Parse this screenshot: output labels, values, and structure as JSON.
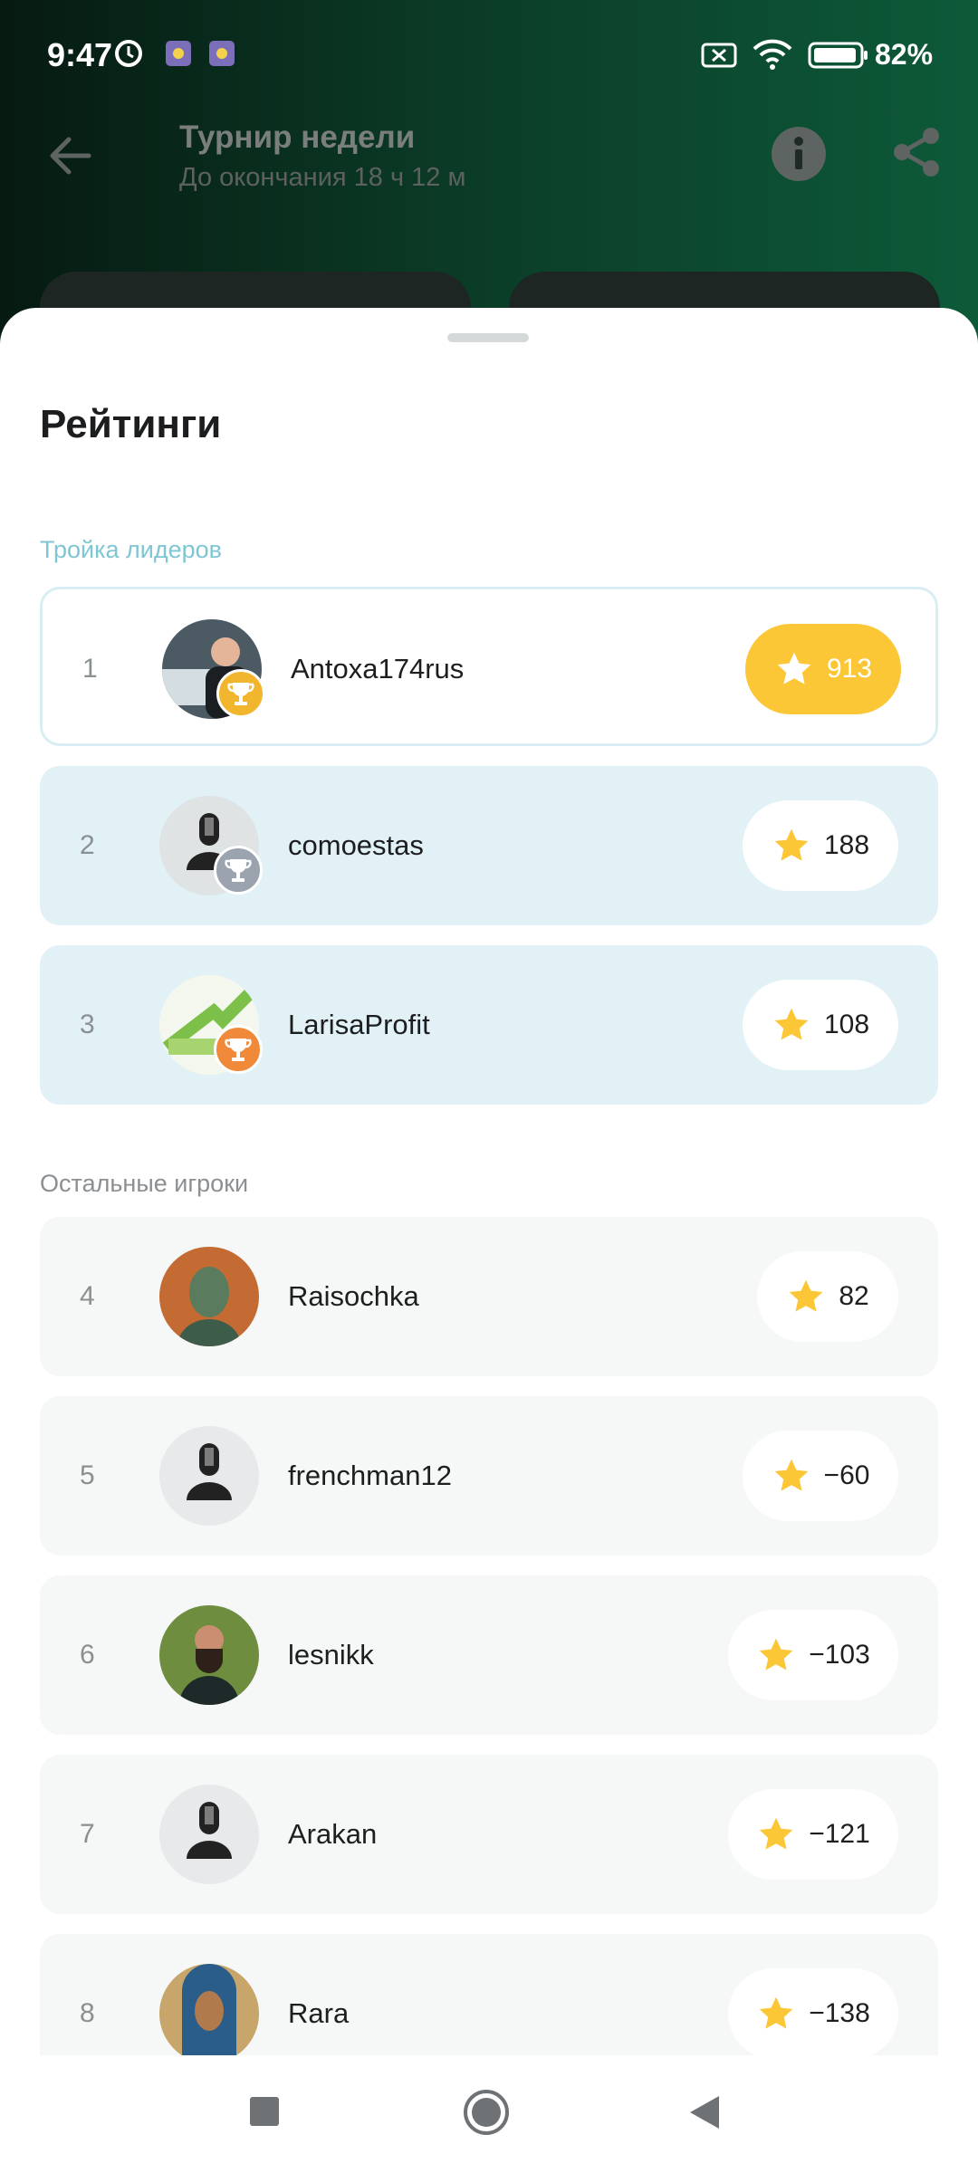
{
  "status": {
    "time": "9:47",
    "battery": "82%"
  },
  "toolbar": {
    "title": "Турнир недели",
    "subtitle": "До окончания 18 ч 12 м"
  },
  "sheet": {
    "title": "Рейтинги",
    "leaders_heading": "Тройка лидеров",
    "others_heading": "Остальные игроки"
  },
  "leaders": [
    {
      "rank": "1",
      "name": "Antoxa174rus",
      "score": "913"
    },
    {
      "rank": "2",
      "name": "comoestas",
      "score": "188"
    },
    {
      "rank": "3",
      "name": "LarisaProfit",
      "score": "108"
    }
  ],
  "others": [
    {
      "rank": "4",
      "name": "Raisochka",
      "score": "82"
    },
    {
      "rank": "5",
      "name": "frenchman12",
      "score": "−60"
    },
    {
      "rank": "6",
      "name": "lesnikk",
      "score": "−103"
    },
    {
      "rank": "7",
      "name": "Arakan",
      "score": "−121"
    },
    {
      "rank": "8",
      "name": "Rara",
      "score": "−138"
    }
  ],
  "colors": {
    "accent_gold": "#fcc737",
    "highlight": "#e1f1f6",
    "section_blue": "#7ec6d3"
  },
  "icons": [
    "alarm-icon",
    "wifi-icon",
    "battery-icon",
    "back-arrow-icon",
    "info-icon",
    "share-icon",
    "star-icon",
    "trophy-icon",
    "default-avatar-icon"
  ]
}
